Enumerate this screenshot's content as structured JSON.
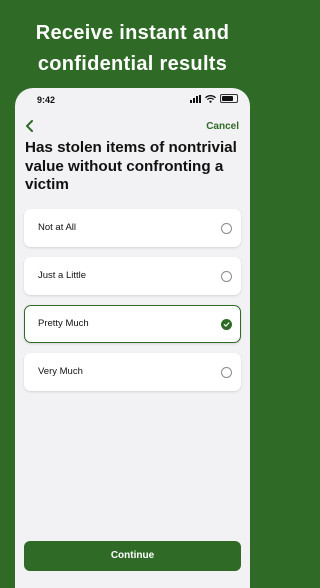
{
  "headline": {
    "line1": "Receive instant and",
    "line2": "confidential results"
  },
  "status_bar": {
    "time": "9:42"
  },
  "nav": {
    "cancel_label": "Cancel"
  },
  "question": "Has stolen items of nontrivial value without confronting a victim",
  "options": [
    {
      "label": "Not at All",
      "selected": false
    },
    {
      "label": "Just a Little",
      "selected": false
    },
    {
      "label": "Pretty Much",
      "selected": true
    },
    {
      "label": "Very Much",
      "selected": false
    }
  ],
  "continue_label": "Continue",
  "colors": {
    "brand": "#2f6a26",
    "background": "#f2f2f4",
    "card": "#ffffff"
  },
  "icons": {
    "back": "chevron-left-icon",
    "selected": "check-circle-icon",
    "unselected": "radio-empty-icon"
  }
}
